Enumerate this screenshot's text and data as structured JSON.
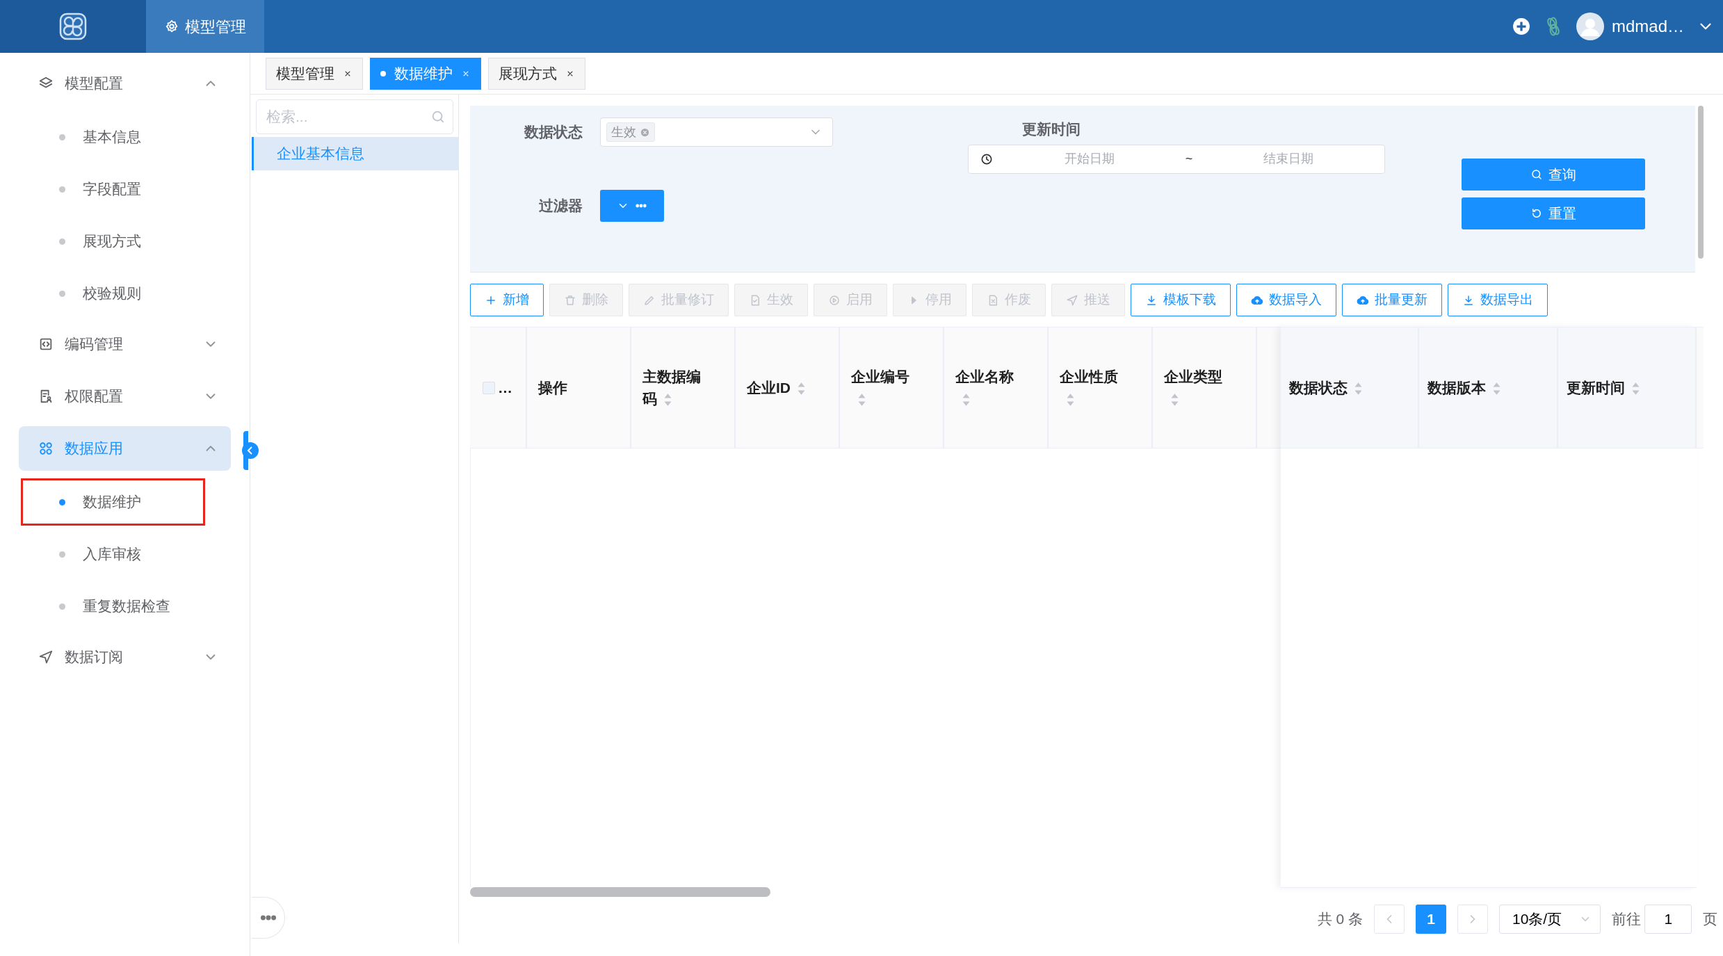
{
  "header": {
    "nav_items": [
      {
        "label": "模型管理",
        "selected": true
      }
    ],
    "user": {
      "name": "mdmad…"
    }
  },
  "sidebar": {
    "items": [
      {
        "label": "模型配置",
        "selected": false,
        "expanded": true,
        "children": [
          {
            "label": "基本信息",
            "selected": false,
            "annotated": false
          },
          {
            "label": "字段配置",
            "selected": false,
            "annotated": false
          },
          {
            "label": "展现方式",
            "selected": false,
            "annotated": false
          },
          {
            "label": "校验规则",
            "selected": false,
            "annotated": false
          }
        ]
      },
      {
        "label": "编码管理",
        "selected": false,
        "expanded": false
      },
      {
        "label": "权限配置",
        "selected": false,
        "expanded": false
      },
      {
        "label": "数据应用",
        "selected": true,
        "expanded": true,
        "children": [
          {
            "label": "数据维护",
            "selected": true,
            "annotated": true
          },
          {
            "label": "入库审核",
            "selected": false,
            "annotated": false
          },
          {
            "label": "重复数据检查",
            "selected": false,
            "annotated": false
          }
        ]
      },
      {
        "label": "数据订阅",
        "selected": false,
        "expanded": false
      }
    ]
  },
  "tabs": [
    {
      "label": "模型管理",
      "selected": false
    },
    {
      "label": "数据维护",
      "selected": true
    },
    {
      "label": "展现方式",
      "selected": false
    }
  ],
  "tree": {
    "search": {
      "placeholder": "检索..."
    },
    "items": [
      {
        "label": "企业基本信息",
        "selected": true
      }
    ]
  },
  "filters": {
    "status": {
      "label": "数据状态",
      "tags": [
        "生效"
      ]
    },
    "filter": {
      "label": "过滤器"
    },
    "update_time": {
      "label": "更新时间",
      "start": {
        "placeholder": "开始日期"
      },
      "separator": "~",
      "end": {
        "placeholder": "结束日期"
      }
    },
    "buttons": [
      "查询",
      "重置"
    ]
  },
  "toolbar": [
    {
      "label": "新增",
      "disabled": false
    },
    {
      "label": "删除",
      "disabled": true
    },
    {
      "label": "批量修订",
      "disabled": true
    },
    {
      "label": "生效",
      "disabled": true
    },
    {
      "label": "启用",
      "disabled": true
    },
    {
      "label": "停用",
      "disabled": true
    },
    {
      "label": "作废",
      "disabled": true
    },
    {
      "label": "推送",
      "disabled": true
    },
    {
      "label": "模板下载",
      "disabled": false
    },
    {
      "label": "数据导入",
      "disabled": false
    },
    {
      "label": "批量更新",
      "disabled": false
    },
    {
      "label": "数据导出",
      "disabled": false
    }
  ],
  "table": {
    "checkbox_label": "…",
    "columns": [
      {
        "label": "操作",
        "sortable": false
      },
      {
        "label": "主数据编码",
        "sortable": true
      },
      {
        "label": "企业ID",
        "sortable": true
      },
      {
        "label": "企业编号",
        "sortable": true
      },
      {
        "label": "企业名称",
        "sortable": true
      },
      {
        "label": "企业性质",
        "sortable": true
      },
      {
        "label": "企业类型",
        "sortable": true
      }
    ],
    "fixed_columns": [
      {
        "label": "数据状态",
        "sortable": true
      },
      {
        "label": "数据版本",
        "sortable": true
      },
      {
        "label": "更新时间",
        "sortable": true
      }
    ]
  },
  "pagination": {
    "total": "共 0 条",
    "pages": [
      {
        "label": "1",
        "selected": true
      }
    ],
    "page_size": "10条/页",
    "goto_label": "前往",
    "goto_value": "1",
    "page_suffix": "页"
  }
}
